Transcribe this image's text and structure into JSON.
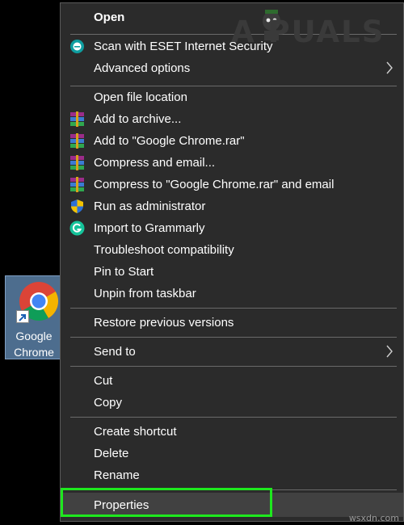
{
  "desktop": {
    "icon_label_line1": "Google",
    "icon_label_line2": "Chrome"
  },
  "watermark": {
    "text": "A  PUALS",
    "site": "wsxdn.com"
  },
  "menu": {
    "open": "Open",
    "scan_eset": "Scan with ESET Internet Security",
    "advanced_options": "Advanced options",
    "open_file_location": "Open file location",
    "add_to_archive": "Add to archive...",
    "add_to_rar": "Add to \"Google Chrome.rar\"",
    "compress_email": "Compress and email...",
    "compress_rar_email": "Compress to \"Google Chrome.rar\" and email",
    "run_as_admin": "Run as administrator",
    "import_grammarly": "Import to Grammarly",
    "troubleshoot": "Troubleshoot compatibility",
    "pin_to_start": "Pin to Start",
    "unpin_taskbar": "Unpin from taskbar",
    "restore_previous": "Restore previous versions",
    "send_to": "Send to",
    "cut": "Cut",
    "copy": "Copy",
    "create_shortcut": "Create shortcut",
    "delete": "Delete",
    "rename": "Rename",
    "properties": "Properties"
  },
  "icons": {
    "eset": "eset-icon",
    "winrar": "winrar-icon",
    "shield": "uac-shield-icon",
    "grammarly": "grammarly-icon",
    "chevron": "chevron-right-icon"
  },
  "colors": {
    "menu_bg": "#2b2b2b",
    "selected_bg": "#414141",
    "highlight_border": "#1ee81e"
  }
}
